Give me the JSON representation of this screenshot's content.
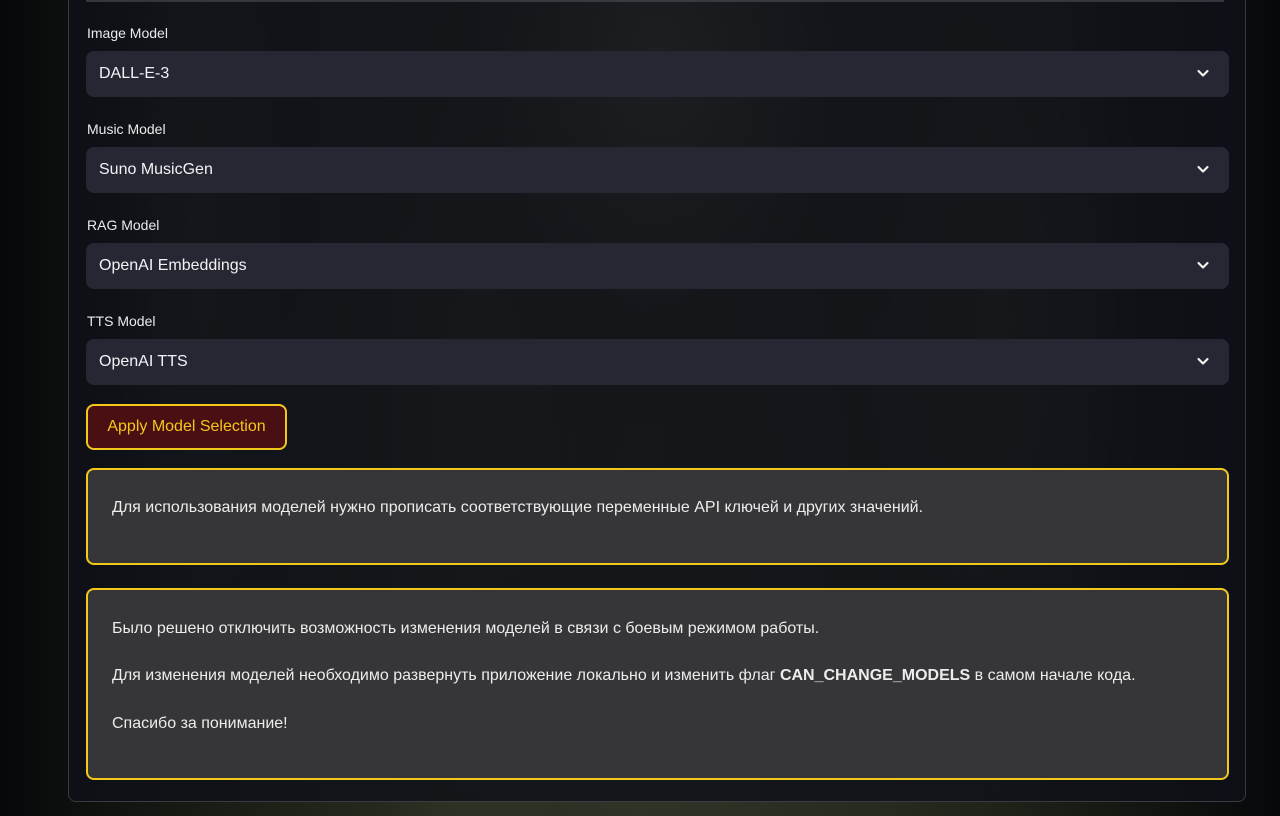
{
  "fields": [
    {
      "label": "Image Model",
      "value": "DALL-E-3"
    },
    {
      "label": "Music Model",
      "value": "Suno MusicGen"
    },
    {
      "label": "RAG Model",
      "value": "OpenAI Embeddings"
    },
    {
      "label": "TTS Model",
      "value": "OpenAI TTS"
    }
  ],
  "apply_button": {
    "label": "Apply Model Selection"
  },
  "notice1": {
    "text": "Для использования моделей нужно прописать соответствующие переменные API ключей и других значений."
  },
  "notice2": {
    "line1": "Было решено отключить возможность изменения моделей в связи с боевым режимом работы.",
    "line2_before": "Для изменения моделей необходимо развернуть приложение локально и изменить флаг ",
    "line2_flag": "CAN_CHANGE_MODELS",
    "line2_after": " в самом начале кода.",
    "line3": "Спасибо за понимание!"
  },
  "colors": {
    "accent": "#f2c81a",
    "button_bg": "#4a0f12",
    "select_bg": "#262733",
    "notice_bg": "#3a3a3c"
  },
  "icons": {
    "select_arrow": "chevron-down-icon"
  }
}
